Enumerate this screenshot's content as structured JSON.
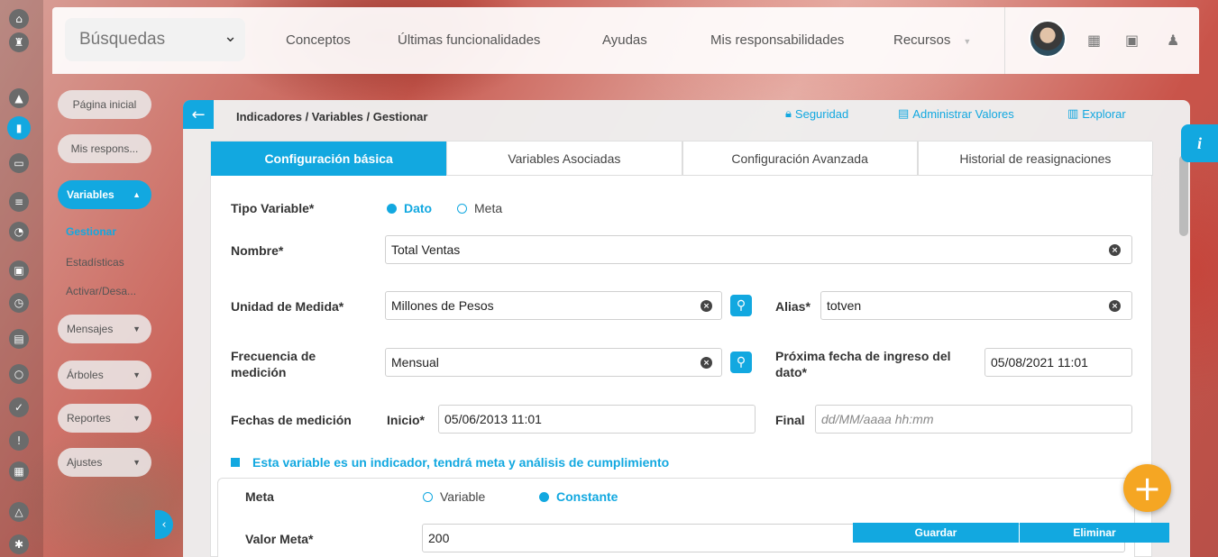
{
  "topbar": {
    "search_label": "Búsquedas",
    "nav": [
      "Conceptos",
      "Últimas funcionalidades",
      "Ayudas",
      "Mis responsabilidades",
      "Recursos"
    ]
  },
  "rail": {
    "icons": [
      "home-icon",
      "rook-icon",
      "warning-icon",
      "chart-icon",
      "presentation-icon",
      "list-icon",
      "pie-icon",
      "briefcase-icon",
      "clock-icon",
      "document-icon",
      "cycle-icon",
      "check-icon",
      "alert-icon",
      "calendar-icon",
      "network-icon",
      "gear-icon"
    ]
  },
  "sidebar": {
    "home": "Página inicial",
    "mis_respons": "Mis respons...",
    "variables": "Variables",
    "sub": [
      "Gestionar",
      "Estadísticas",
      "Activar/Desa..."
    ],
    "mensajes": "Mensajes",
    "arboles": "Árboles",
    "reportes": "Reportes",
    "ajustes": "Ajustes"
  },
  "header": {
    "breadcrumb": "Indicadores / Variables / Gestionar",
    "seguridad": "Seguridad",
    "administrar": "Administrar Valores",
    "explorar": "Explorar"
  },
  "tabs": [
    "Configuración básica",
    "Variables Asociadas",
    "Configuración Avanzada",
    "Historial de reasignaciones"
  ],
  "form": {
    "tipo_variable_label": "Tipo Variable*",
    "tipo_dato": "Dato",
    "tipo_meta": "Meta",
    "nombre_label": "Nombre*",
    "nombre_value": "Total Ventas",
    "unidad_label": "Unidad de Medida*",
    "unidad_value": "Millones de Pesos",
    "alias_label": "Alias*",
    "alias_value": "totven",
    "frecuencia_label": "Frecuencia de medición",
    "frecuencia_value": "Mensual",
    "proxima_label": "Próxima fecha de ingreso del dato*",
    "proxima_value": "05/08/2021 11:01",
    "fechas_label": "Fechas de medición",
    "inicio_label": "Inicio*",
    "inicio_value": "05/06/2013 11:01",
    "final_label": "Final",
    "final_placeholder": "dd/MM/aaaa hh:mm",
    "indicator_text": "Esta variable es un indicador, tendrá meta y análisis de cumplimiento",
    "meta_label": "Meta",
    "meta_variable": "Variable",
    "meta_constante": "Constante",
    "valor_meta_label": "Valor Meta*",
    "valor_meta_value": "200",
    "guardar": "Guardar",
    "eliminar": "Eliminar"
  },
  "colors": {
    "accent": "#12a8e0",
    "fab": "#f5a623"
  }
}
